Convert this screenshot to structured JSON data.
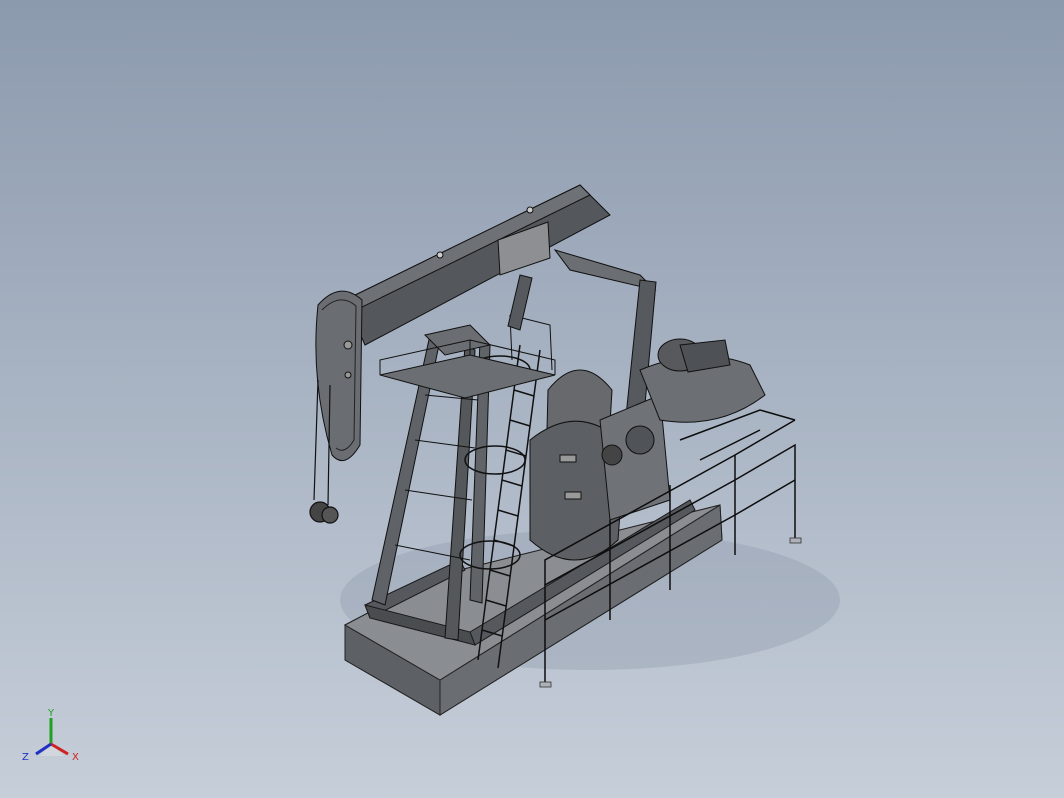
{
  "viewport": {
    "background_top": "#8c9aae",
    "background_bottom": "#c6ced9",
    "model_name_icon": "pumpjack-model"
  },
  "triad": {
    "x_label": "X",
    "y_label": "Y",
    "z_label": "Z",
    "x_color": "#d02020",
    "y_color": "#20a020",
    "z_color": "#2030c0"
  }
}
